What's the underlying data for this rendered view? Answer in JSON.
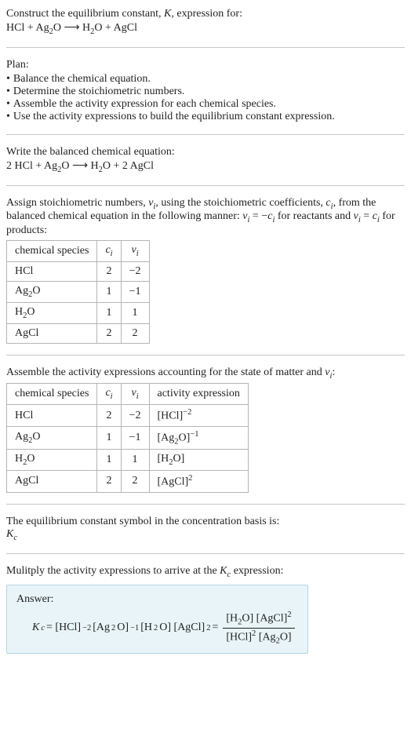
{
  "header": {
    "line1": "Construct the equilibrium constant, ",
    "K": "K",
    "line1b": ", expression for:",
    "eq_lhs": "HCl + Ag",
    "eq_sub1": "2",
    "eq_mid": "O ",
    "arrow": "⟶",
    "eq_rhs": " H",
    "eq_sub2": "2",
    "eq_end": "O + AgCl"
  },
  "plan": {
    "title": "Plan:",
    "items": [
      "Balance the chemical equation.",
      "Determine the stoichiometric numbers.",
      "Assemble the activity expression for each chemical species.",
      "Use the activity expressions to build the equilibrium constant expression."
    ]
  },
  "balanced": {
    "title": "Write the balanced chemical equation:",
    "pre": "2 HCl + Ag",
    "s1": "2",
    "mid": "O ",
    "arrow": "⟶",
    "post": " H",
    "s2": "2",
    "end": "O + 2 AgCl"
  },
  "stoich": {
    "intro1": "Assign stoichiometric numbers, ",
    "nu": "ν",
    "sub_i": "i",
    "intro2": ", using the stoichiometric coefficients, ",
    "c": "c",
    "intro3": ", from the balanced chemical equation in the following manner: ",
    "eq1": " = −",
    "intro4": " for reactants and ",
    "eq2": " = ",
    "intro5": " for products:",
    "headers": [
      "chemical species",
      "c",
      "ν"
    ],
    "rows": [
      {
        "species": "HCl",
        "c": "2",
        "nu": "−2"
      },
      {
        "species": "Ag",
        "sub": "2",
        "species2": "O",
        "c": "1",
        "nu": "−1"
      },
      {
        "species": "H",
        "sub": "2",
        "species2": "O",
        "c": "1",
        "nu": "1"
      },
      {
        "species": "AgCl",
        "c": "2",
        "nu": "2"
      }
    ]
  },
  "activity": {
    "intro": "Assemble the activity expressions accounting for the state of matter and ",
    "nu": "ν",
    "sub_i": "i",
    "colon": ":",
    "headers": [
      "chemical species",
      "c",
      "ν",
      "activity expression"
    ],
    "rows": [
      {
        "species": "HCl",
        "c": "2",
        "nu": "−2",
        "expr_base": "[HCl]",
        "expr_exp": "−2"
      },
      {
        "species": "Ag",
        "sub": "2",
        "species2": "O",
        "c": "1",
        "nu": "−1",
        "expr_base": "[Ag",
        "expr_sub": "2",
        "expr_base2": "O]",
        "expr_exp": "−1"
      },
      {
        "species": "H",
        "sub": "2",
        "species2": "O",
        "c": "1",
        "nu": "1",
        "expr_base": "[H",
        "expr_sub": "2",
        "expr_base2": "O]"
      },
      {
        "species": "AgCl",
        "c": "2",
        "nu": "2",
        "expr_base": "[AgCl]",
        "expr_exp": "2"
      }
    ]
  },
  "kc_intro": {
    "line": "The equilibrium constant symbol in the concentration basis is:",
    "K": "K",
    "sub": "c"
  },
  "multiply": {
    "pre": "Mulitply the activity expressions to arrive at the ",
    "K": "K",
    "sub": "c",
    "post": " expression:"
  },
  "answer": {
    "label": "Answer:",
    "Kc": "K",
    "Kc_sub": "c",
    "eq": " = [HCl]",
    "e1": "−2",
    "p2": " [Ag",
    "s2": "2",
    "p3": "O]",
    "e2": "−1",
    "p4": " [H",
    "s3": "2",
    "p5": "O] [AgCl]",
    "e3": "2",
    "eqmid": " = ",
    "num1": "[H",
    "num_s1": "2",
    "num2": "O] [AgCl]",
    "num_e": "2",
    "den1": "[HCl]",
    "den_e1": "2",
    "den2": " [Ag",
    "den_s": "2",
    "den3": "O]"
  }
}
